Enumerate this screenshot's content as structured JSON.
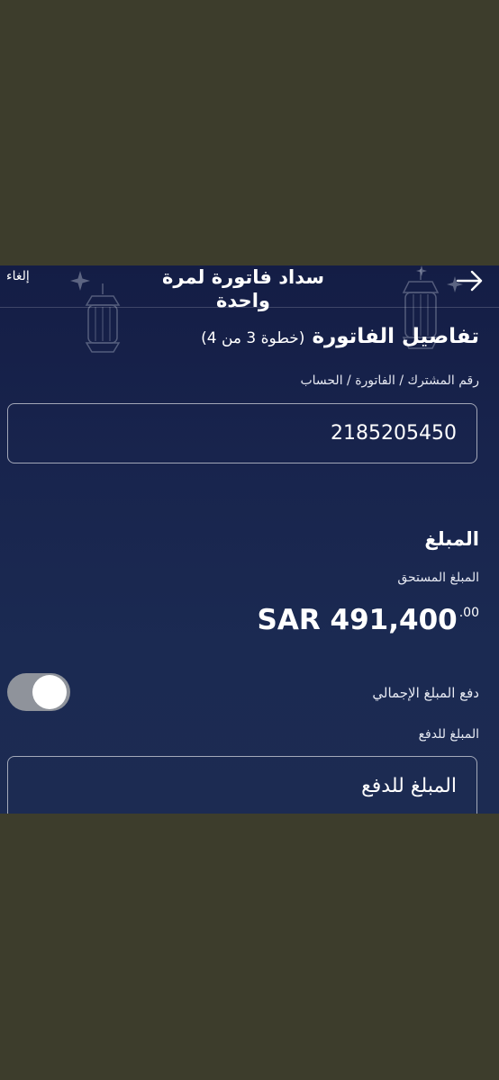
{
  "header": {
    "title": "سداد فاتورة لمرة واحدة",
    "cancel_label": "إلغاء"
  },
  "invoice_details": {
    "title": "تفاصيل الفاتورة",
    "step": "(خطوة 3 من 4)",
    "account_label": "رقم المشترك / الفاتورة / الحساب",
    "account_value": "2185205450"
  },
  "amount": {
    "title": "المبلغ",
    "due_label": "المبلغ المستحق",
    "due_main": "SAR 491,400",
    "due_decimals": ".00",
    "pay_full_label": "دفع المبلغ الإجمالي",
    "pay_full_on": false,
    "pay_amount_label": "المبلغ للدفع",
    "pay_amount_placeholder": "المبلغ للدفع"
  }
}
